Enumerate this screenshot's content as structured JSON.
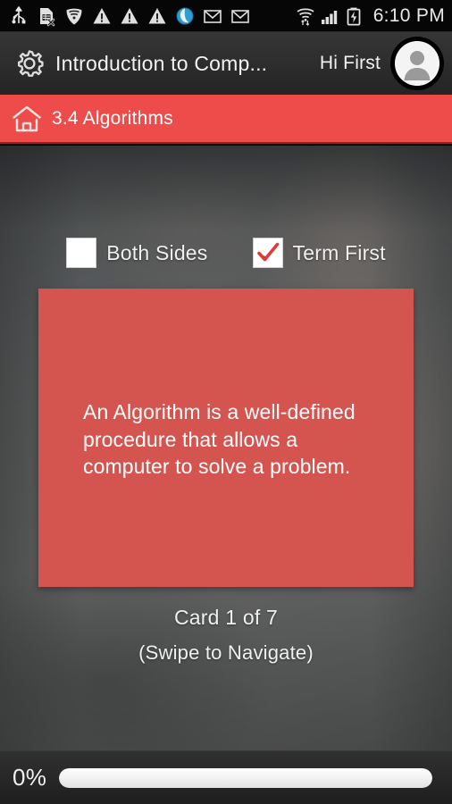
{
  "statusbar": {
    "time": "6:10 PM",
    "icons": [
      {
        "name": "usb-icon"
      },
      {
        "name": "sim-card-error-icon"
      },
      {
        "name": "wifi-shield-icon"
      },
      {
        "name": "warning-triangle-icon-1"
      },
      {
        "name": "warning-triangle-icon-2"
      },
      {
        "name": "warning-triangle-icon-3"
      },
      {
        "name": "browser-globe-icon"
      },
      {
        "name": "gmail-icon-1"
      },
      {
        "name": "gmail-icon-2"
      },
      {
        "name": "wifi-transfer-icon"
      },
      {
        "name": "cellular-signal-icon"
      },
      {
        "name": "battery-charging-icon"
      }
    ]
  },
  "header": {
    "settings_icon": "gear-icon",
    "title": "Introduction to Comp...",
    "greeting": "Hi First",
    "avatar_icon": "user-avatar-icon"
  },
  "breadcrumb": {
    "home_icon": "home-icon",
    "label": "3.4 Algorithms"
  },
  "options": {
    "both_sides": {
      "label": "Both Sides",
      "checked": false
    },
    "term_first": {
      "label": "Term First",
      "checked": true
    }
  },
  "flashcard": {
    "text": "An Algorithm is a well-defined procedure that allows a computer to solve a problem.",
    "counter": "Card 1 of 7",
    "hint": "(Swipe to Navigate)"
  },
  "progress": {
    "percent_label": "0%",
    "value": 0
  },
  "colors": {
    "breadcrumb_red": "#ee4b4b",
    "card_red": "#d4544f",
    "check_red": "#e03a35",
    "header_dark": "#2c2c2c",
    "status_black": "#060606",
    "text_light": "#f0f0f0"
  }
}
